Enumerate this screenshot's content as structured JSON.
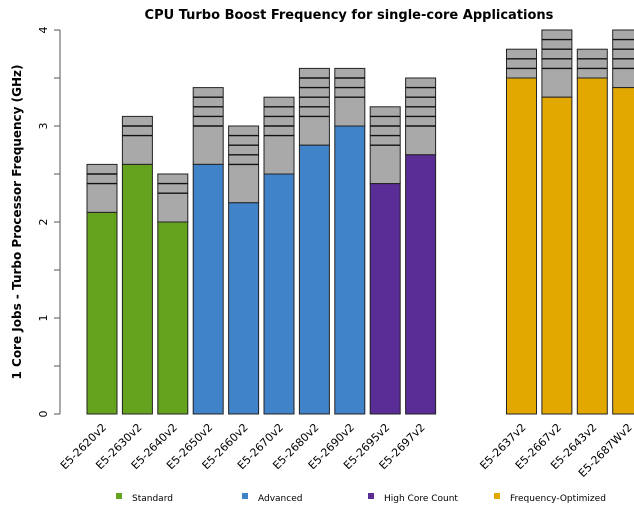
{
  "chart_data": {
    "type": "bar",
    "stacked": true,
    "title": "CPU Turbo Boost Frequency for single-core Applications",
    "xlabel": "",
    "ylabel": "1 Core Jobs - Turbo Processor Frequency (GHz)",
    "ylim": [
      0,
      4
    ],
    "yticks": [
      0,
      1,
      2,
      3,
      4
    ],
    "yminor_ticks": [
      0.5,
      1.5,
      2.5,
      3.5
    ],
    "grid": false,
    "legend_position": "bottom",
    "turbo_color": "#a9a9a9",
    "groups": [
      {
        "name": "Standard",
        "color": "#65a31f"
      },
      {
        "name": "Advanced",
        "color": "#4183c8"
      },
      {
        "name": "High Core Count",
        "color": "#5a2c95"
      },
      {
        "name": "Frequency-Optimized",
        "color": "#e3a800"
      }
    ],
    "categories": [
      "E5-2620v2",
      "E5-2630v2",
      "E5-2640v2",
      "E5-2650v2",
      "E5-2660v2",
      "E5-2670v2",
      "E5-2680v2",
      "E5-2690v2",
      "E5-2695v2",
      "E5-2697v2",
      "E5-2637v2",
      "E5-2667v2",
      "E5-2643v2",
      "E5-2687Wv2"
    ],
    "category_groups": [
      0,
      0,
      0,
      1,
      1,
      1,
      1,
      1,
      2,
      2,
      3,
      3,
      3,
      3
    ],
    "base_frequency": [
      2.1,
      2.6,
      2.0,
      2.6,
      2.2,
      2.5,
      2.8,
      3.0,
      2.4,
      2.7,
      3.5,
      3.3,
      3.5,
      3.4
    ],
    "turbo_steps": [
      [
        2.4,
        2.5,
        2.6
      ],
      [
        2.9,
        3.0,
        3.1
      ],
      [
        2.3,
        2.4,
        2.5
      ],
      [
        3.0,
        3.1,
        3.2,
        3.3,
        3.4
      ],
      [
        2.6,
        2.7,
        2.8,
        2.9,
        3.0
      ],
      [
        2.9,
        3.0,
        3.1,
        3.2,
        3.3
      ],
      [
        3.1,
        3.2,
        3.3,
        3.4,
        3.5,
        3.6
      ],
      [
        3.3,
        3.4,
        3.5,
        3.6
      ],
      [
        2.8,
        2.9,
        3.0,
        3.1,
        3.2
      ],
      [
        3.0,
        3.1,
        3.2,
        3.3,
        3.4,
        3.5
      ],
      [
        3.6,
        3.7,
        3.8
      ],
      [
        3.6,
        3.7,
        3.8,
        3.9,
        4.0
      ],
      [
        3.6,
        3.7,
        3.8
      ],
      [
        3.6,
        3.7,
        3.8,
        3.9,
        4.0
      ]
    ],
    "max_turbo": [
      2.6,
      3.1,
      2.5,
      3.4,
      3.0,
      3.3,
      3.6,
      3.6,
      3.2,
      3.5,
      3.8,
      4.0,
      3.8,
      4.0
    ]
  }
}
